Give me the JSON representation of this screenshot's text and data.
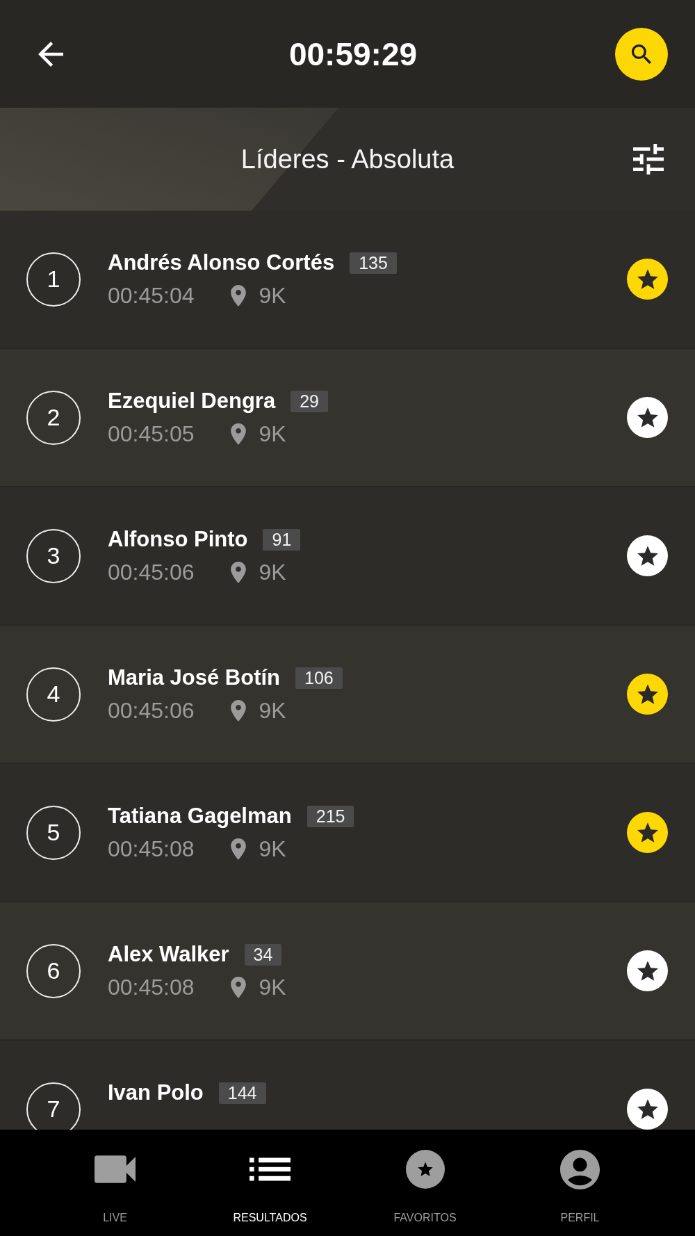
{
  "header": {
    "title": "00:59:29"
  },
  "subheader": {
    "title": "Líderes - Absoluta"
  },
  "leaders": [
    {
      "rank": "1",
      "name": "Andrés Alonso Cortés",
      "bib": "135",
      "time": "00:45:04",
      "distance": "9K",
      "favorite": true
    },
    {
      "rank": "2",
      "name": "Ezequiel Dengra",
      "bib": "29",
      "time": "00:45:05",
      "distance": "9K",
      "favorite": false
    },
    {
      "rank": "3",
      "name": "Alfonso Pinto",
      "bib": "91",
      "time": "00:45:06",
      "distance": "9K",
      "favorite": false
    },
    {
      "rank": "4",
      "name": "Maria José Botín",
      "bib": "106",
      "time": "00:45:06",
      "distance": "9K",
      "favorite": true
    },
    {
      "rank": "5",
      "name": "Tatiana Gagelman",
      "bib": "215",
      "time": "00:45:08",
      "distance": "9K",
      "favorite": true
    },
    {
      "rank": "6",
      "name": "Alex Walker",
      "bib": "34",
      "time": "00:45:08",
      "distance": "9K",
      "favorite": false
    },
    {
      "rank": "7",
      "name": "Ivan Polo",
      "bib": "144",
      "favorite": false
    }
  ],
  "bottom_nav": [
    {
      "label": "LIVE",
      "kind": "video",
      "selected": false
    },
    {
      "label": "RESULTADOS",
      "kind": "list",
      "selected": true
    },
    {
      "label": "FAVORITOS",
      "kind": "star",
      "selected": false
    },
    {
      "label": "PERFIL",
      "kind": "person",
      "selected": false
    }
  ]
}
